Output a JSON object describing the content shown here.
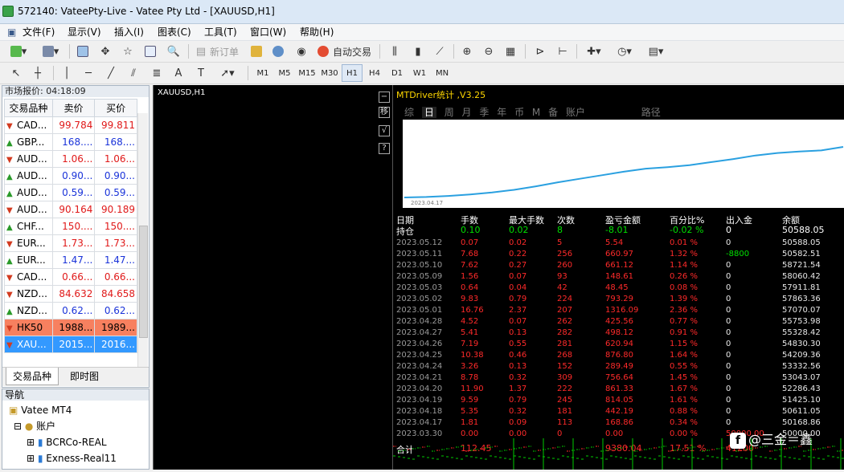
{
  "window": {
    "title": "572140: VateePty-Live - Vatee Pty Ltd - [XAUUSD,H1]"
  },
  "menu": [
    "文件(F)",
    "显示(V)",
    "插入(I)",
    "图表(C)",
    "工具(T)",
    "窗口(W)",
    "帮助(H)"
  ],
  "toolbar": {
    "new_order": "新订单",
    "auto_trade": "自动交易"
  },
  "timeframes": [
    "M1",
    "M5",
    "M15",
    "M30",
    "H1",
    "H4",
    "D1",
    "W1",
    "MN"
  ],
  "active_timeframe": "H1",
  "market_watch": {
    "header": "市场报价: 04:18:09",
    "col_symbol": "交易品种",
    "col_bid": "卖价",
    "col_ask": "买价",
    "rows": [
      {
        "dir": "down",
        "symbol": "CAD...",
        "bid": "99.784",
        "ask": "99.811",
        "color": "red"
      },
      {
        "dir": "up",
        "symbol": "GBP...",
        "bid": "168....",
        "ask": "168....",
        "color": "blue"
      },
      {
        "dir": "down",
        "symbol": "AUD...",
        "bid": "1.06...",
        "ask": "1.06...",
        "color": "red"
      },
      {
        "dir": "up",
        "symbol": "AUD...",
        "bid": "0.90...",
        "ask": "0.90...",
        "color": "blue"
      },
      {
        "dir": "up",
        "symbol": "AUD...",
        "bid": "0.59...",
        "ask": "0.59...",
        "color": "blue"
      },
      {
        "dir": "down",
        "symbol": "AUD...",
        "bid": "90.164",
        "ask": "90.189",
        "color": "red"
      },
      {
        "dir": "up",
        "symbol": "CHF...",
        "bid": "150....",
        "ask": "150....",
        "color": "red"
      },
      {
        "dir": "down",
        "symbol": "EUR...",
        "bid": "1.73...",
        "ask": "1.73...",
        "color": "red"
      },
      {
        "dir": "up",
        "symbol": "EUR...",
        "bid": "1.47...",
        "ask": "1.47...",
        "color": "blue"
      },
      {
        "dir": "down",
        "symbol": "CAD...",
        "bid": "0.66...",
        "ask": "0.66...",
        "color": "red"
      },
      {
        "dir": "down",
        "symbol": "NZD...",
        "bid": "84.632",
        "ask": "84.658",
        "color": "red"
      },
      {
        "dir": "up",
        "symbol": "NZD...",
        "bid": "0.62...",
        "ask": "0.62...",
        "color": "blue"
      },
      {
        "dir": "down",
        "symbol": "HK50",
        "bid": "1988...",
        "ask": "1989...",
        "color": "hk"
      },
      {
        "dir": "down",
        "symbol": "XAU...",
        "bid": "2015...",
        "ask": "2016...",
        "color": "sel"
      }
    ],
    "tabs": [
      "交易品种",
      "即时图"
    ]
  },
  "navigator": {
    "header": "导航",
    "items": [
      "Vatee MT4",
      "账户",
      "BCRCo-REAL",
      "Exness-Real11"
    ]
  },
  "chart": {
    "symbol_label": "XAUUSD,H1",
    "side_icons": [
      "移",
      "√",
      "?"
    ]
  },
  "mtdriver": {
    "title": "MTDriver统计 ,V3.25",
    "tabs": [
      "综",
      "日",
      "周",
      "月",
      "季",
      "年",
      "币",
      "M",
      "备",
      "账户",
      "路径"
    ],
    "active_tab": "日",
    "equity_start_label": "2023.04.17",
    "equity_curve": [
      0.0,
      0.01,
      0.03,
      0.06,
      0.1,
      0.15,
      0.22,
      0.3,
      0.37,
      0.44,
      0.51,
      0.57,
      0.6,
      0.64,
      0.7,
      0.76,
      0.83,
      0.88,
      0.91,
      0.93,
      1.0
    ],
    "headers": [
      "日期",
      "手数",
      "最大手数",
      "次数",
      "盈亏金额",
      "百分比%",
      "出入金",
      "余额"
    ],
    "holding": [
      "持仓",
      "0.10",
      "0.02",
      "8",
      "-8.01",
      "-0.02 %",
      "0",
      "50588.05"
    ],
    "rows": [
      [
        "2023.05.12",
        "0.07",
        "0.02",
        "5",
        "5.54",
        "0.01 %",
        "0",
        "50588.05"
      ],
      [
        "2023.05.11",
        "7.68",
        "0.22",
        "256",
        "660.97",
        "1.32 %",
        "-8800",
        "50582.51"
      ],
      [
        "2023.05.10",
        "7.62",
        "0.27",
        "260",
        "661.12",
        "1.14 %",
        "0",
        "58721.54"
      ],
      [
        "2023.05.09",
        "1.56",
        "0.07",
        "93",
        "148.61",
        "0.26 %",
        "0",
        "58060.42"
      ],
      [
        "2023.05.03",
        "0.64",
        "0.04",
        "42",
        "48.45",
        "0.08 %",
        "0",
        "57911.81"
      ],
      [
        "2023.05.02",
        "9.83",
        "0.79",
        "224",
        "793.29",
        "1.39 %",
        "0",
        "57863.36"
      ],
      [
        "2023.05.01",
        "16.76",
        "2.37",
        "207",
        "1316.09",
        "2.36 %",
        "0",
        "57070.07"
      ],
      [
        "2023.04.28",
        "4.52",
        "0.07",
        "262",
        "425.56",
        "0.77 %",
        "0",
        "55753.98"
      ],
      [
        "2023.04.27",
        "5.41",
        "0.13",
        "282",
        "498.12",
        "0.91 %",
        "0",
        "55328.42"
      ],
      [
        "2023.04.26",
        "7.19",
        "0.55",
        "281",
        "620.94",
        "1.15 %",
        "0",
        "54830.30"
      ],
      [
        "2023.04.25",
        "10.38",
        "0.46",
        "268",
        "876.80",
        "1.64 %",
        "0",
        "54209.36"
      ],
      [
        "2023.04.24",
        "3.26",
        "0.13",
        "152",
        "289.49",
        "0.55 %",
        "0",
        "53332.56"
      ],
      [
        "2023.04.21",
        "8.78",
        "0.32",
        "309",
        "756.64",
        "1.45 %",
        "0",
        "53043.07"
      ],
      [
        "2023.04.20",
        "11.90",
        "1.37",
        "222",
        "861.33",
        "1.67 %",
        "0",
        "52286.43"
      ],
      [
        "2023.04.19",
        "9.59",
        "0.79",
        "245",
        "814.05",
        "1.61 %",
        "0",
        "51425.10"
      ],
      [
        "2023.04.18",
        "5.35",
        "0.32",
        "181",
        "442.19",
        "0.88 %",
        "0",
        "50611.05"
      ],
      [
        "2023.04.17",
        "1.81",
        "0.09",
        "113",
        "168.86",
        "0.34 %",
        "0",
        "50168.86"
      ],
      [
        "2023.03.30",
        "0.00",
        "0.00",
        "0",
        "0.00",
        "0.00 %",
        "50000.00",
        "50000.00"
      ]
    ],
    "total": [
      "合计",
      "112.45",
      "",
      "",
      "9380.04",
      "17.51 %",
      "41200",
      ""
    ]
  },
  "watermark": "@三金＝鑫",
  "colors": {
    "sel": "#3399ff",
    "hk": "#f7805f",
    "positive": "#ff2a2a",
    "holding": "#00e000",
    "curve": "#2aa0e0"
  }
}
